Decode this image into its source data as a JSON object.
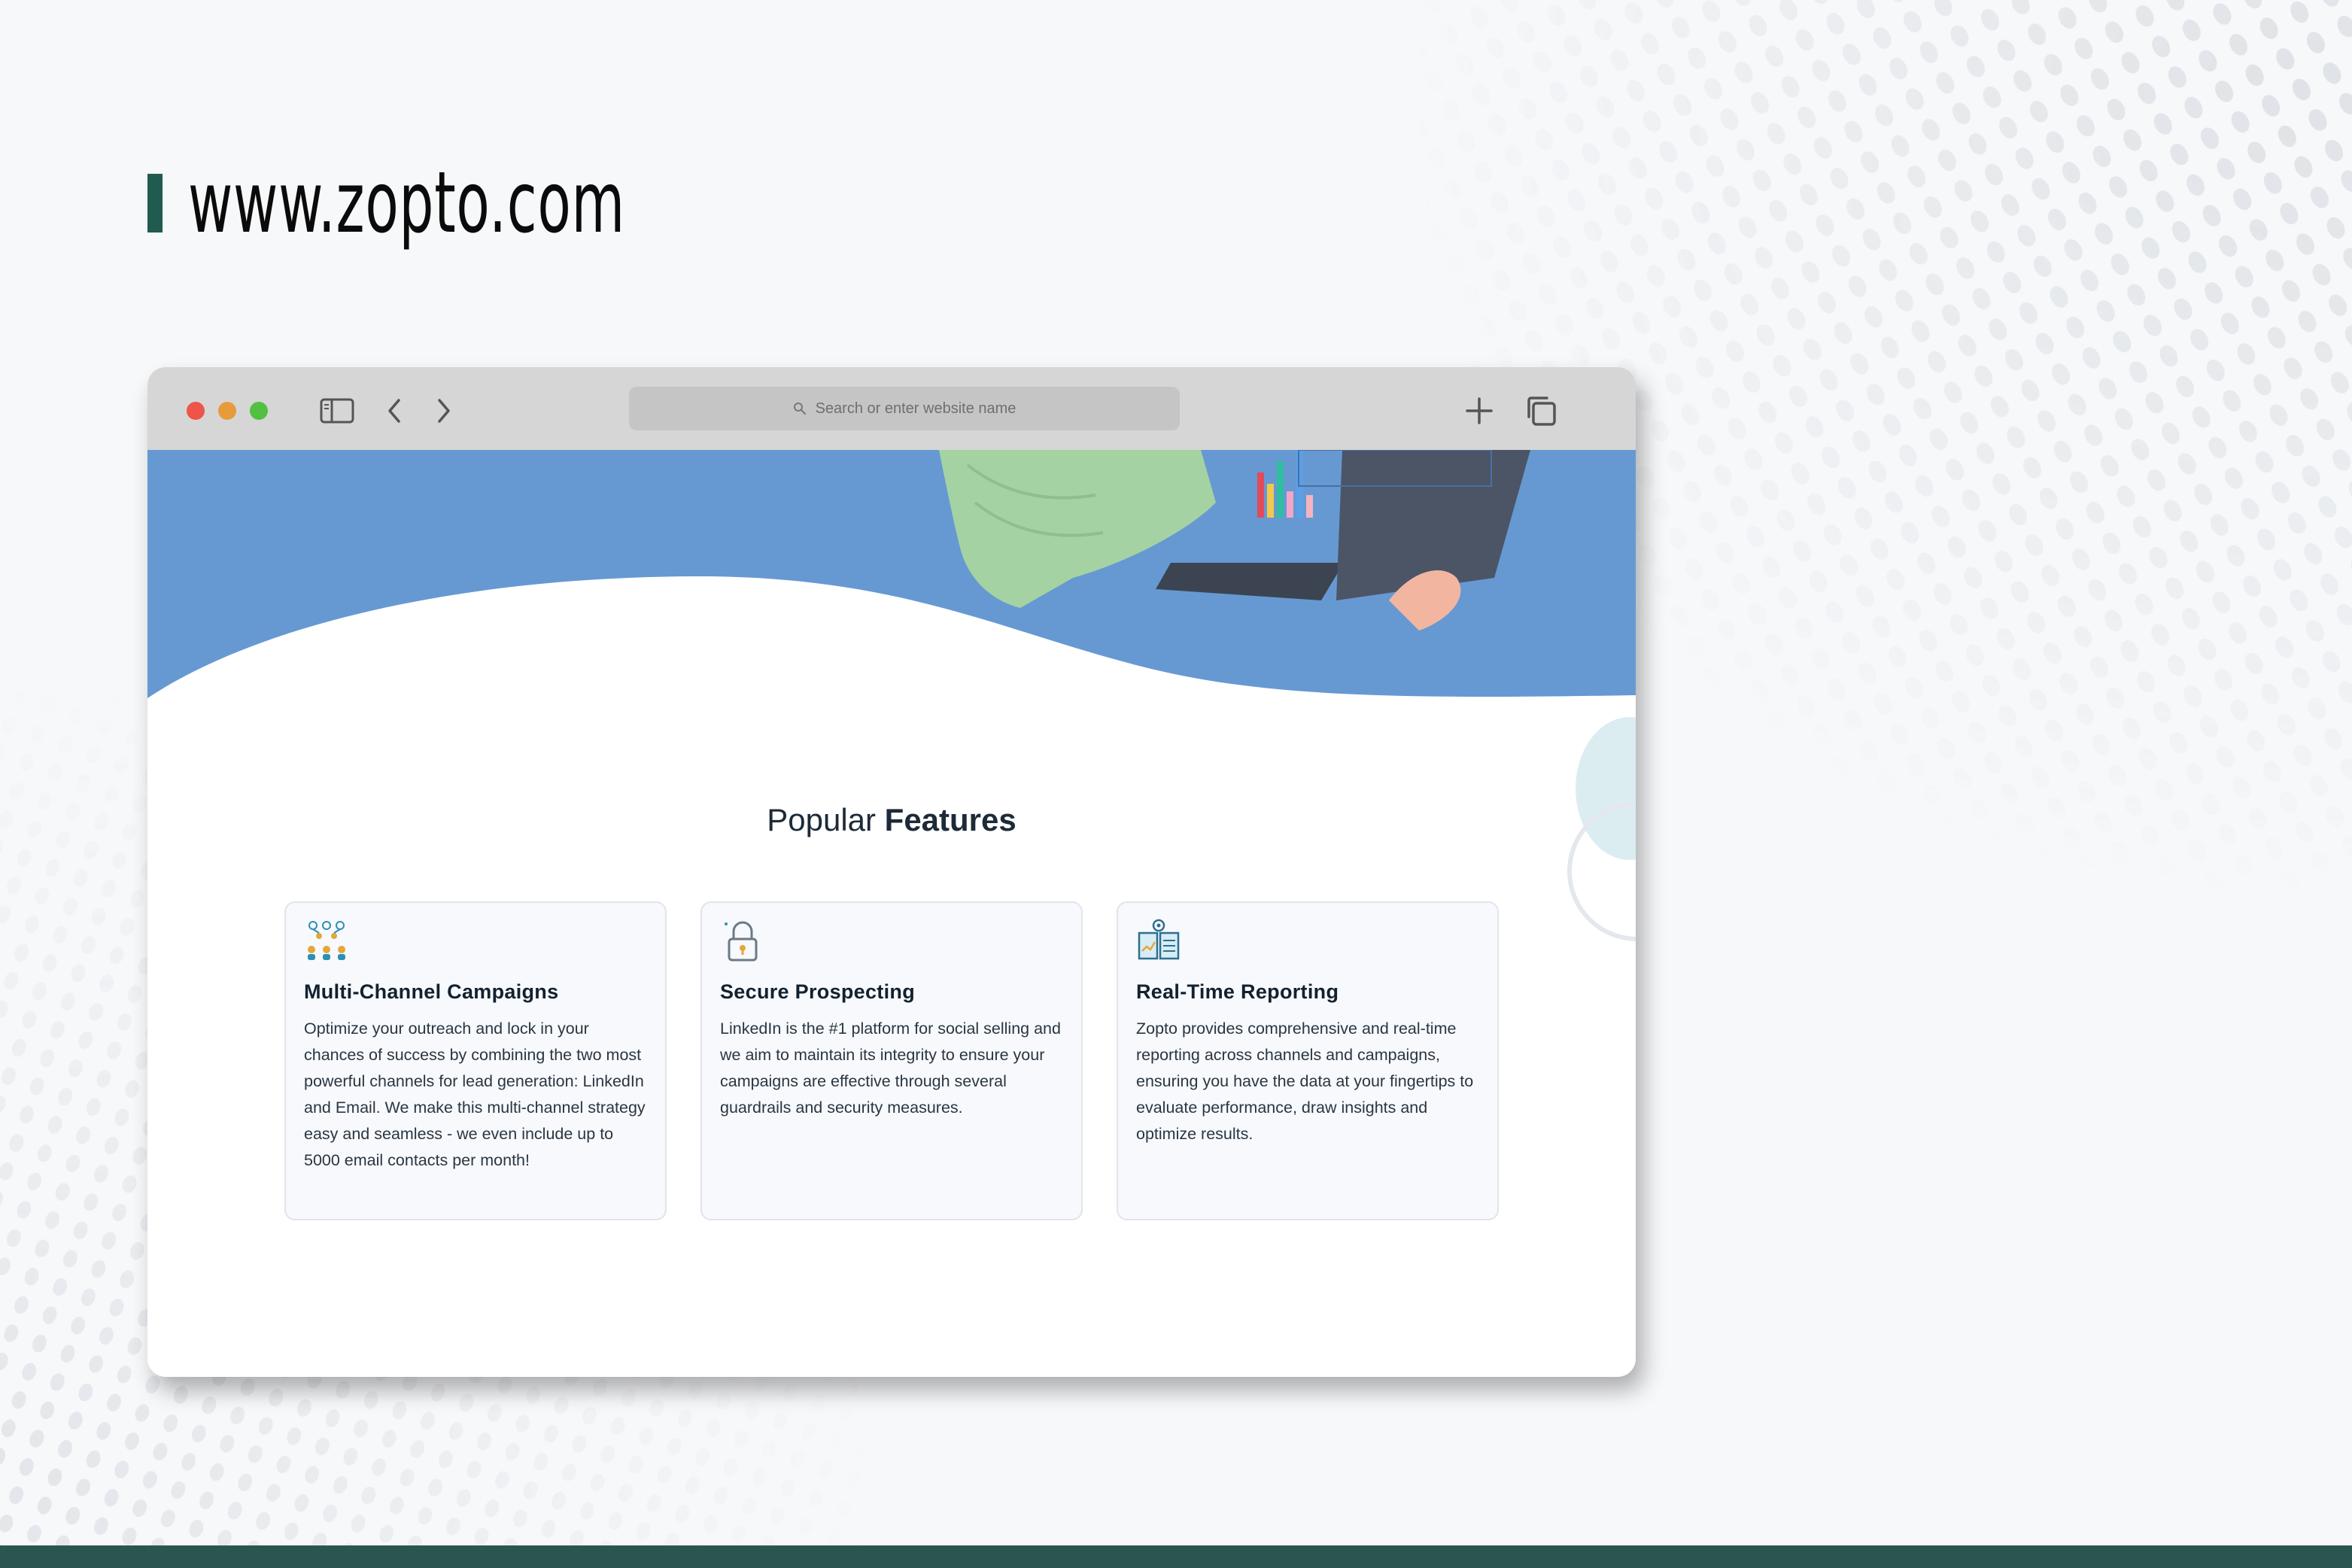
{
  "page": {
    "site_url": "www.zopto.com",
    "accent_color": "#215a4e",
    "footer_band_color": "#2b564f"
  },
  "browser": {
    "toolbar": {
      "search_placeholder": "Search or enter website name",
      "icons": [
        "close-window-icon",
        "minimize-window-icon",
        "maximize-window-icon",
        "sidebar-toggle-icon",
        "back-arrow-icon",
        "forward-arrow-icon",
        "search-icon",
        "new-tab-icon",
        "tabs-overview-icon"
      ]
    },
    "hero": {
      "background_color": "#6699d2"
    },
    "features": {
      "title_light": "Popular",
      "title_bold": "Features",
      "cards": [
        {
          "icon": "network-people-icon",
          "title": "Multi-Channel Campaigns",
          "description": "Optimize your outreach and lock in your chances of success by combining the two most powerful channels for lead generation: LinkedIn and Email. We make this multi-channel strategy easy and seamless - we even include up to 5000 email contacts per month!"
        },
        {
          "icon": "padlock-icon",
          "title": "Secure Prospecting",
          "description": "LinkedIn is the #1 platform for social selling and we aim to maintain its integrity to ensure your campaigns are effective through several guardrails and security measures."
        },
        {
          "icon": "report-book-icon",
          "title": "Real-Time Reporting",
          "description": "Zopto provides comprehensive and real-time reporting across channels and campaigns, ensuring you have the data at your fingertips to evaluate performance, draw insights and optimize results."
        }
      ]
    }
  }
}
